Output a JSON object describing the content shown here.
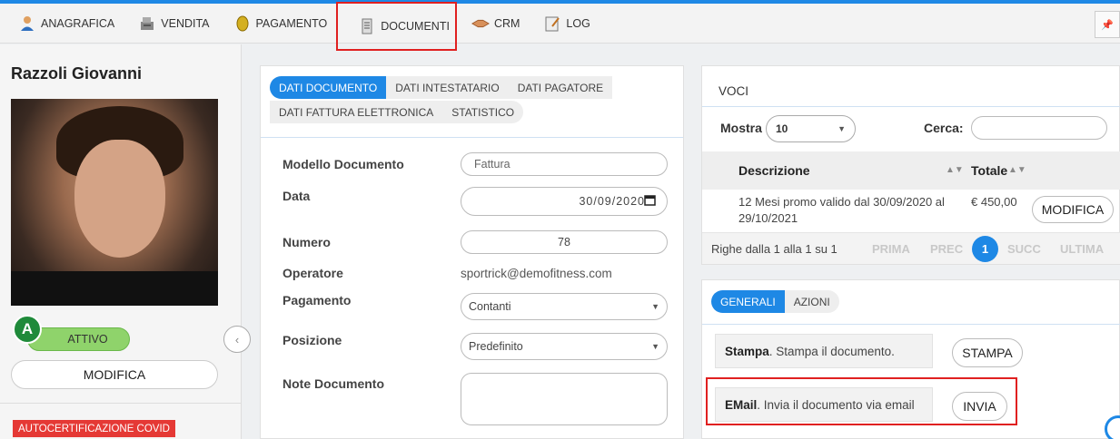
{
  "nav": {
    "items": [
      {
        "label": "ANAGRAFICA",
        "icon": "user-icon"
      },
      {
        "label": "VENDITA",
        "icon": "cash-register-icon"
      },
      {
        "label": "PAGAMENTO",
        "icon": "coin-icon"
      },
      {
        "label": "DOCUMENTI",
        "icon": "document-icon"
      },
      {
        "label": "CRM",
        "icon": "handshake-icon"
      },
      {
        "label": "LOG",
        "icon": "notepad-icon"
      }
    ],
    "highlighted": "DOCUMENTI"
  },
  "profile": {
    "name": "Razzoli Giovanni",
    "badge_letter": "A",
    "status": "ATTIVO",
    "edit_label": "MODIFICA",
    "covid_tag": "AUTOCERTIFICAZIONE COVID"
  },
  "doc_form": {
    "tabs_row1": [
      "DATI DOCUMENTO",
      "DATI INTESTATARIO",
      "DATI PAGATORE"
    ],
    "tabs_row2": [
      "DATI FATTURA ELETTRONICA",
      "STATISTICO"
    ],
    "active_tab": "DATI DOCUMENTO",
    "fields": {
      "modello": {
        "label": "Modello Documento",
        "placeholder": "Fattura"
      },
      "data": {
        "label": "Data",
        "value": "30/09/2020"
      },
      "numero": {
        "label": "Numero",
        "value": "78"
      },
      "operatore": {
        "label": "Operatore",
        "value": "sportrick@demofitness.com"
      },
      "pagamento": {
        "label": "Pagamento",
        "value": "Contanti"
      },
      "posizione": {
        "label": "Posizione",
        "value": "Predefinito"
      },
      "note": {
        "label": "Note Documento",
        "value": ""
      }
    }
  },
  "voci": {
    "title": "VOCI",
    "mostra_label": "Mostra",
    "mostra_value": "10",
    "cerca_label": "Cerca:",
    "columns": [
      "Descrizione",
      "Totale"
    ],
    "rows": [
      {
        "descrizione": "12 Mesi promo valido dal 30/09/2020 al 29/10/2021",
        "totale": "€ 450,00",
        "action": "MODIFICA"
      }
    ],
    "pager": {
      "info": "Righe dalla 1 alla 1 su 1",
      "prima": "PRIMA",
      "prec": "PREC",
      "current": "1",
      "succ": "SUCC",
      "ultima": "ULTIMA"
    }
  },
  "actions": {
    "tabs": [
      "GENERALI",
      "AZIONI"
    ],
    "active_tab": "GENERALI",
    "stampa": {
      "title": "Stampa",
      "desc": ". Stampa il documento.",
      "button": "STAMPA"
    },
    "email": {
      "title": "EMail",
      "desc": ". Invia il documento via email",
      "button": "INVIA"
    }
  },
  "colors": {
    "accent": "#1e88e5",
    "status_green": "#8fd36b",
    "badge_green": "#1f8a3a",
    "highlight_red": "#e02020",
    "covid_red": "#e53935"
  }
}
